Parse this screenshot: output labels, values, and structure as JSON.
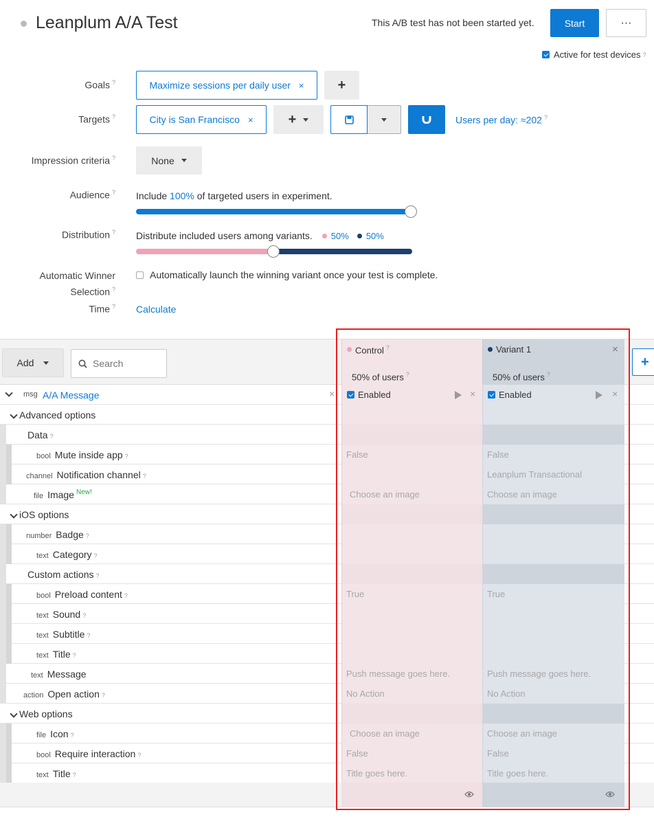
{
  "header": {
    "title": "Leanplum A/A Test",
    "status": "This A/B test has not been started yet.",
    "start_label": "Start",
    "more_label": "···",
    "active_label": "Active for test devices"
  },
  "form": {
    "goals_label": "Goals",
    "goal_chip": "Maximize sessions per daily user",
    "targets_label": "Targets",
    "target_chip": "City is San Francisco",
    "users_per_day": "Users per day: ≈202",
    "impression_label": "Impression criteria",
    "impression_value": "None",
    "audience_label": "Audience",
    "audience_prefix": "Include",
    "audience_pct": "100%",
    "audience_suffix": "of targeted users in experiment.",
    "audience_fraction": 1.0,
    "distribution_label": "Distribution",
    "distribution_text": "Distribute included users among variants.",
    "dist_a": "50%",
    "dist_b": "50%",
    "auto_label_1": "Automatic Winner",
    "auto_label_2": "Selection",
    "auto_text": "Automatically launch the winning variant once your test is complete.",
    "time_label": "Time",
    "calculate": "Calculate",
    "question": "?"
  },
  "toolbar": {
    "add_label": "Add",
    "search_placeholder": "Search"
  },
  "variants": {
    "control_name": "Control",
    "control_users": "50% of users",
    "variant_name": "Variant 1",
    "variant_users": "50% of users",
    "enabled": "Enabled"
  },
  "msg_row": {
    "type": "msg",
    "name": "A/A Message"
  },
  "rows": [
    {
      "indent": 1,
      "section": true,
      "type": "",
      "name": "Advanced options",
      "help": false,
      "c": "",
      "v": "",
      "new": ""
    },
    {
      "indent": 2,
      "section": false,
      "type": "",
      "name": "Data",
      "help": true,
      "c": "",
      "v": "",
      "new": "",
      "dark": true
    },
    {
      "indent": 3,
      "section": false,
      "type": "bool",
      "name": "Mute inside app",
      "help": true,
      "c": "False",
      "v": "False",
      "new": ""
    },
    {
      "indent": 3,
      "section": false,
      "type": "channel",
      "name": "Notification channel",
      "help": true,
      "c": "",
      "v": "Leanplum Transactional",
      "new": ""
    },
    {
      "indent": 2,
      "section": false,
      "type": "file",
      "name": "Image",
      "help": false,
      "c": "Choose an image",
      "v": "Choose an image",
      "new": "New!"
    },
    {
      "indent": 1,
      "section": true,
      "type": "",
      "name": "iOS options",
      "help": false,
      "c": "",
      "v": "",
      "new": "",
      "dark": true
    },
    {
      "indent": 3,
      "section": false,
      "type": "number",
      "name": "Badge",
      "help": true,
      "c": "",
      "v": "",
      "new": ""
    },
    {
      "indent": 3,
      "section": false,
      "type": "text",
      "name": "Category",
      "help": true,
      "c": "",
      "v": "",
      "new": ""
    },
    {
      "indent": 2,
      "section": false,
      "type": "",
      "name": "Custom actions",
      "help": true,
      "c": "",
      "v": "",
      "new": "",
      "dark": true
    },
    {
      "indent": 3,
      "section": false,
      "type": "bool",
      "name": "Preload content",
      "help": true,
      "c": "True",
      "v": "True",
      "new": ""
    },
    {
      "indent": 3,
      "section": false,
      "type": "text",
      "name": "Sound",
      "help": true,
      "c": "",
      "v": "",
      "new": ""
    },
    {
      "indent": 3,
      "section": false,
      "type": "text",
      "name": "Subtitle",
      "help": true,
      "c": "",
      "v": "",
      "new": ""
    },
    {
      "indent": 3,
      "section": false,
      "type": "text",
      "name": "Title",
      "help": true,
      "c": "",
      "v": "",
      "new": ""
    },
    {
      "indent": 2,
      "section": false,
      "type": "text",
      "name": "Message",
      "help": false,
      "c": "Push message goes here.",
      "v": "Push message goes here.",
      "new": ""
    },
    {
      "indent": 2,
      "section": false,
      "type": "action",
      "name": "Open action",
      "help": true,
      "c": "No Action",
      "v": "No Action",
      "new": ""
    },
    {
      "indent": 1,
      "section": true,
      "type": "",
      "name": "Web options",
      "help": false,
      "c": "",
      "v": "",
      "new": "",
      "dark": true
    },
    {
      "indent": 3,
      "section": false,
      "type": "file",
      "name": "Icon",
      "help": true,
      "c": "Choose an image",
      "v": "Choose an image",
      "new": ""
    },
    {
      "indent": 3,
      "section": false,
      "type": "bool",
      "name": "Require interaction",
      "help": true,
      "c": "False",
      "v": "False",
      "new": ""
    },
    {
      "indent": 3,
      "section": false,
      "type": "text",
      "name": "Title",
      "help": true,
      "c": "Title goes here.",
      "v": "Title goes here.",
      "new": ""
    }
  ],
  "colors": {
    "accent": "#0d7ad3",
    "control": "#f3e4e7",
    "variant": "#dfe3ea",
    "highlight": "#e8211f",
    "control_dot": "#f0a3b8",
    "variant_dot": "#1c3f6e"
  }
}
